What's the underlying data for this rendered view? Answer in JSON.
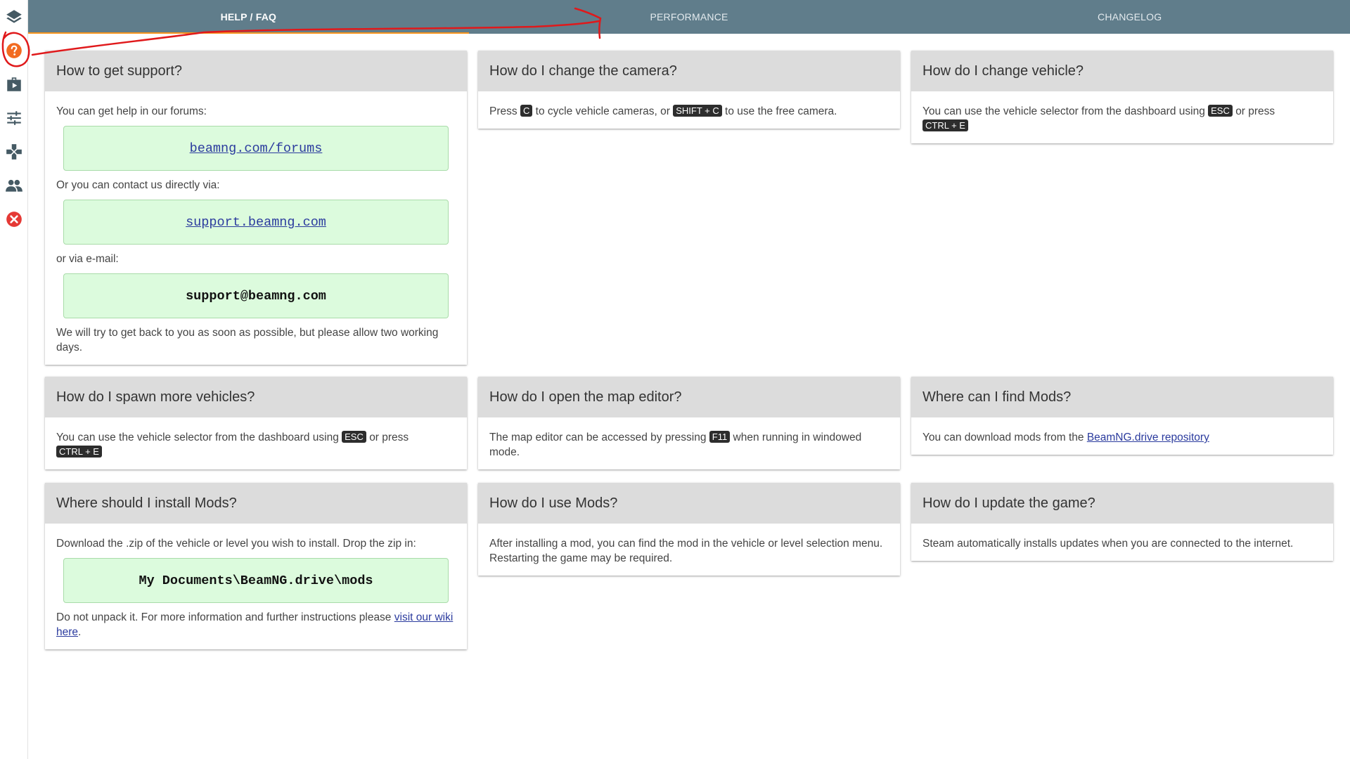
{
  "colors": {
    "tabbar": "#607d8b",
    "active_underline": "#f7941d",
    "card_header": "#dcdcdc",
    "code_box": "#dcfbdd",
    "annotation": "#e0191b",
    "help_icon": "#f26b21",
    "close_icon": "#e53935"
  },
  "sidebar": {
    "items": [
      {
        "name": "layers-icon"
      },
      {
        "name": "help-icon"
      },
      {
        "name": "play-icon"
      },
      {
        "name": "settings-sliders-icon"
      },
      {
        "name": "gamepad-icon"
      },
      {
        "name": "people-icon"
      },
      {
        "name": "close-icon"
      }
    ]
  },
  "tabs": [
    {
      "label": "HELP / FAQ",
      "active": true
    },
    {
      "label": "PERFORMANCE",
      "active": false
    },
    {
      "label": "CHANGELOG",
      "active": false
    }
  ],
  "cards": {
    "support": {
      "title": "How to get support?",
      "intro": "You can get help in our forums:",
      "forums_link": "beamng.com/forums",
      "contact_text": "Or you can contact us directly via:",
      "support_link": "support.beamng.com",
      "email_text": "or via e-mail:",
      "email": "support@beamng.com",
      "footer": "We will try to get back to you as soon as possible, but please allow two working days."
    },
    "camera": {
      "title": "How do I change the camera?",
      "text1": "Press",
      "key1": "C",
      "text2": "to cycle vehicle cameras, or",
      "key2": "SHIFT + C",
      "text3": "to use the free camera."
    },
    "vehicle": {
      "title": "How do I change vehicle?",
      "text1": "You can use the vehicle selector from the dashboard using",
      "key1": "ESC",
      "text2": "or press",
      "key2": "CTRL + E"
    },
    "spawn": {
      "title": "How do I spawn more vehicles?",
      "text1": "You can use the vehicle selector from the dashboard using",
      "key1": "ESC",
      "text2": "or press",
      "key2": "CTRL + E"
    },
    "editor": {
      "title": "How do I open the map editor?",
      "text1": "The map editor can be accessed by pressing",
      "key1": "F11",
      "text2": "when running in windowed mode."
    },
    "findmods": {
      "title": "Where can I find Mods?",
      "text1": "You can download mods from the",
      "link": "BeamNG.drive repository"
    },
    "install": {
      "title": "Where should I install Mods?",
      "text1": "Download the .zip of the vehicle or level you wish to install. Drop the zip in:",
      "path": "My Documents\\BeamNG.drive\\mods",
      "text2": "Do not unpack it. For more information and further instructions please",
      "link": "visit our wiki here",
      "text3": "."
    },
    "usemods": {
      "title": "How do I use Mods?",
      "text1": "After installing a mod, you can find the mod in the vehicle or level selection menu. Restarting the game may be required."
    },
    "update": {
      "title": "How do I update the game?",
      "text1": "Steam automatically installs updates when you are connected to the internet."
    }
  }
}
